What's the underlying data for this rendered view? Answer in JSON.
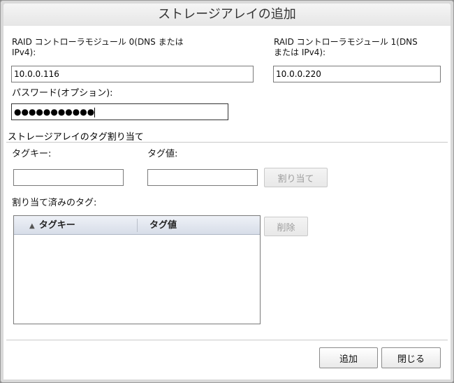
{
  "dialog": {
    "title": "ストレージアレイの追加"
  },
  "controllers": {
    "module0_label_line1": "RAID コントローラモジュール 0(DNS または",
    "module0_label_line2": "IPv4):",
    "module0_value": "10.0.0.116",
    "module1_label_line1": "RAID コントローラモジュール 1(DNS",
    "module1_label_line2": "または IPv4):",
    "module1_value": "10.0.0.220"
  },
  "password": {
    "label": "パスワード(オプション):",
    "masked_value": "●●●●●●●●●●●"
  },
  "tags": {
    "section_title": "ストレージアレイのタグ割り当て",
    "key_label": "タグキー:",
    "value_label": "タグ値:",
    "key_value": "",
    "value_value": "",
    "assign_button": "割り当て",
    "assigned_label": "割り当て済みのタグ:",
    "columns": [
      "タグキー",
      "タグ値"
    ],
    "sort_indicator": "▲",
    "rows": [],
    "delete_button": "削除"
  },
  "footer": {
    "add_button": "追加",
    "close_button": "閉じる"
  }
}
